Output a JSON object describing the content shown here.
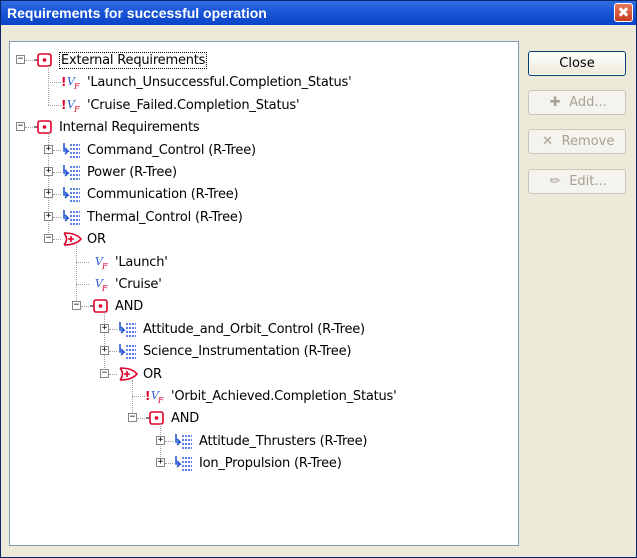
{
  "window": {
    "title": "Requirements for successful operation",
    "close_glyph": "✖"
  },
  "buttons": {
    "close": "Close",
    "add": "Add...",
    "remove": "Remove",
    "edit": "Edit..."
  },
  "tree": [
    {
      "label": "External Requirements",
      "icon": "and-gate-icon",
      "level": 0,
      "expander": "minus",
      "selected": true
    },
    {
      "label": "'Launch_Unsuccessful.Completion_Status'",
      "icon": "negated-variable-icon",
      "level": 1,
      "expander": null
    },
    {
      "label": "'Cruise_Failed.Completion_Status'",
      "icon": "negated-variable-icon",
      "level": 1,
      "expander": null
    },
    {
      "label": "Internal Requirements",
      "icon": "and-gate-icon",
      "level": 0,
      "expander": "minus"
    },
    {
      "label": "Command_Control (R-Tree)",
      "icon": "rtree-icon",
      "level": 1,
      "expander": "plus"
    },
    {
      "label": "Power (R-Tree)",
      "icon": "rtree-icon",
      "level": 1,
      "expander": "plus"
    },
    {
      "label": "Communication (R-Tree)",
      "icon": "rtree-icon",
      "level": 1,
      "expander": "plus"
    },
    {
      "label": "Thermal_Control (R-Tree)",
      "icon": "rtree-icon",
      "level": 1,
      "expander": "plus"
    },
    {
      "label": "OR",
      "icon": "or-gate-icon",
      "level": 1,
      "expander": "minus"
    },
    {
      "label": "'Launch'",
      "icon": "variable-icon",
      "level": 2,
      "expander": null
    },
    {
      "label": "'Cruise'",
      "icon": "variable-icon",
      "level": 2,
      "expander": null
    },
    {
      "label": "AND",
      "icon": "and-gate-icon",
      "level": 2,
      "expander": "minus"
    },
    {
      "label": "Attitude_and_Orbit_Control (R-Tree)",
      "icon": "rtree-icon",
      "level": 3,
      "expander": "plus"
    },
    {
      "label": "Science_Instrumentation (R-Tree)",
      "icon": "rtree-icon",
      "level": 3,
      "expander": "plus"
    },
    {
      "label": "OR",
      "icon": "or-gate-icon",
      "level": 3,
      "expander": "minus"
    },
    {
      "label": "'Orbit_Achieved.Completion_Status'",
      "icon": "negated-variable-icon",
      "level": 4,
      "expander": null
    },
    {
      "label": "AND",
      "icon": "and-gate-icon",
      "level": 4,
      "expander": "minus"
    },
    {
      "label": "Attitude_Thrusters (R-Tree)",
      "icon": "rtree-icon",
      "level": 5,
      "expander": "plus"
    },
    {
      "label": "Ion_Propulsion (R-Tree)",
      "icon": "rtree-icon",
      "level": 5,
      "expander": "plus"
    }
  ],
  "colors": {
    "titlebar": "#0a44c7",
    "icon_red": "#e0002a",
    "icon_blue": "#2a5ad6"
  }
}
